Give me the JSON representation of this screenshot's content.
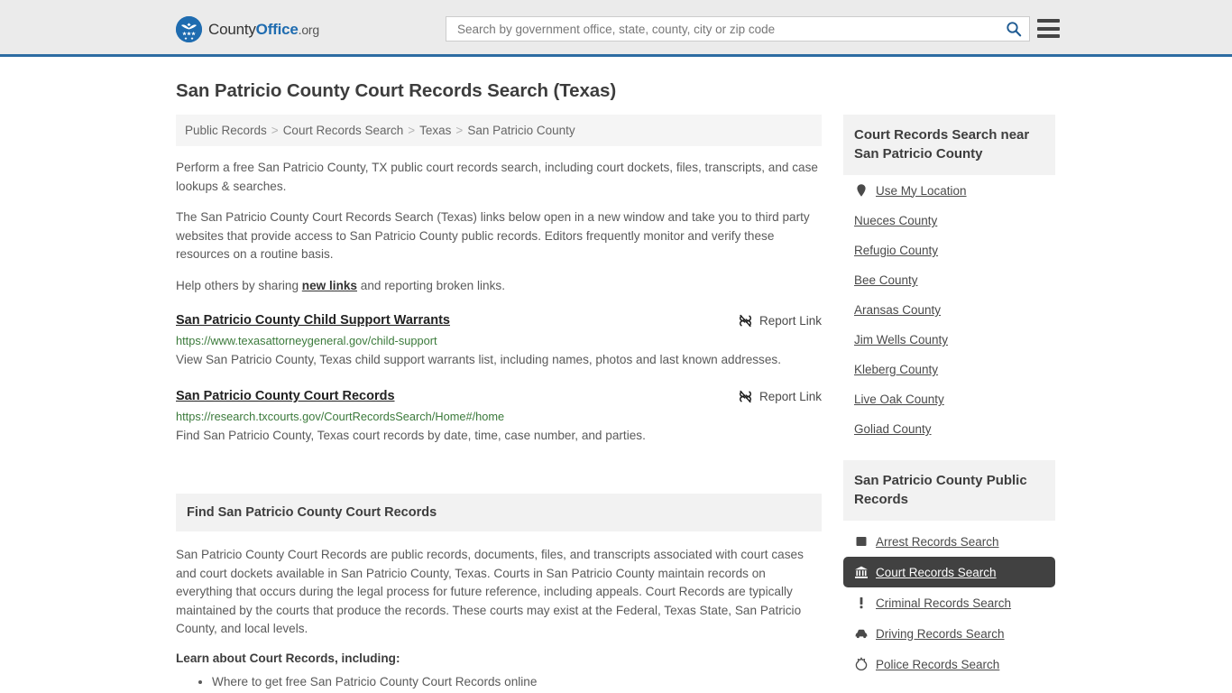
{
  "header": {
    "logo": {
      "part1": "County",
      "part2": "Office",
      "part3": ".org",
      "icon": "eagle-seal-icon"
    },
    "search": {
      "placeholder": "Search by government office, state, county, city or zip code",
      "value": "",
      "icon": "search-icon"
    },
    "menu_icon": "hamburger-menu-icon",
    "accent_color": "#2d6ca2",
    "background_color": "#ebebeb"
  },
  "page_title": "San Patricio County Court Records Search (Texas)",
  "breadcrumb": {
    "separator": ">",
    "items": [
      {
        "label": "Public Records"
      },
      {
        "label": "Court Records Search"
      },
      {
        "label": "Texas"
      },
      {
        "label": "San Patricio County"
      }
    ]
  },
  "intro": {
    "p1": "Perform a free San Patricio County, TX public court records search, including court dockets, files, transcripts, and case lookups & searches.",
    "p2": "The San Patricio County Court Records Search (Texas) links below open in a new window and take you to third party websites that provide access to San Patricio County public records. Editors frequently monitor and verify these resources on a routine basis.",
    "p3_before": "Help others by sharing ",
    "p3_link": "new links",
    "p3_after": " and reporting broken links."
  },
  "entries": [
    {
      "title": "San Patricio County Child Support Warrants",
      "url": "https://www.texasattorneygeneral.gov/child-support",
      "description": "View San Patricio County, Texas child support warrants list, including names, photos and last known addresses.",
      "report_label": "Report Link",
      "report_icon": "unlink-icon"
    },
    {
      "title": "San Patricio County Court Records",
      "url": "https://research.txcourts.gov/CourtRecordsSearch/Home#/home",
      "description": "Find San Patricio County, Texas court records by date, time, case number, and parties.",
      "report_label": "Report Link",
      "report_icon": "unlink-icon"
    }
  ],
  "find_section": {
    "heading": "Find San Patricio County Court Records",
    "body": "San Patricio County Court Records are public records, documents, files, and transcripts associated with court cases and court dockets available in San Patricio County, Texas. Courts in San Patricio County maintain records on everything that occurs during the legal process for future reference, including appeals. Court Records are typically maintained by the courts that produce the records. These courts may exist at the Federal, Texas State, San Patricio County, and local levels.",
    "learn_heading": "Learn about Court Records, including:",
    "bullets": [
      "Where to get free San Patricio County Court Records online"
    ]
  },
  "sidebar": {
    "nearby": {
      "heading": "Court Records Search near San Patricio County",
      "items": [
        {
          "label": "Use My Location",
          "icon": "map-pin-icon"
        },
        {
          "label": "Nueces County",
          "icon": ""
        },
        {
          "label": "Refugio County",
          "icon": ""
        },
        {
          "label": "Bee County",
          "icon": ""
        },
        {
          "label": "Aransas County",
          "icon": ""
        },
        {
          "label": "Jim Wells County",
          "icon": ""
        },
        {
          "label": "Kleberg County",
          "icon": ""
        },
        {
          "label": "Live Oak County",
          "icon": ""
        },
        {
          "label": "Goliad County",
          "icon": ""
        }
      ]
    },
    "public_records": {
      "heading": "San Patricio County Public Records",
      "items": [
        {
          "label": "Arrest Records Search",
          "icon": "fingerprint-square-icon",
          "active": false
        },
        {
          "label": "Court Records Search",
          "icon": "courthouse-icon",
          "active": true
        },
        {
          "label": "Criminal Records Search",
          "icon": "exclamation-icon",
          "active": false
        },
        {
          "label": "Driving Records Search",
          "icon": "car-icon",
          "active": false
        },
        {
          "label": "Police Records Search",
          "icon": "police-badge-icon",
          "active": false
        }
      ]
    },
    "active_background_color": "#414141"
  }
}
